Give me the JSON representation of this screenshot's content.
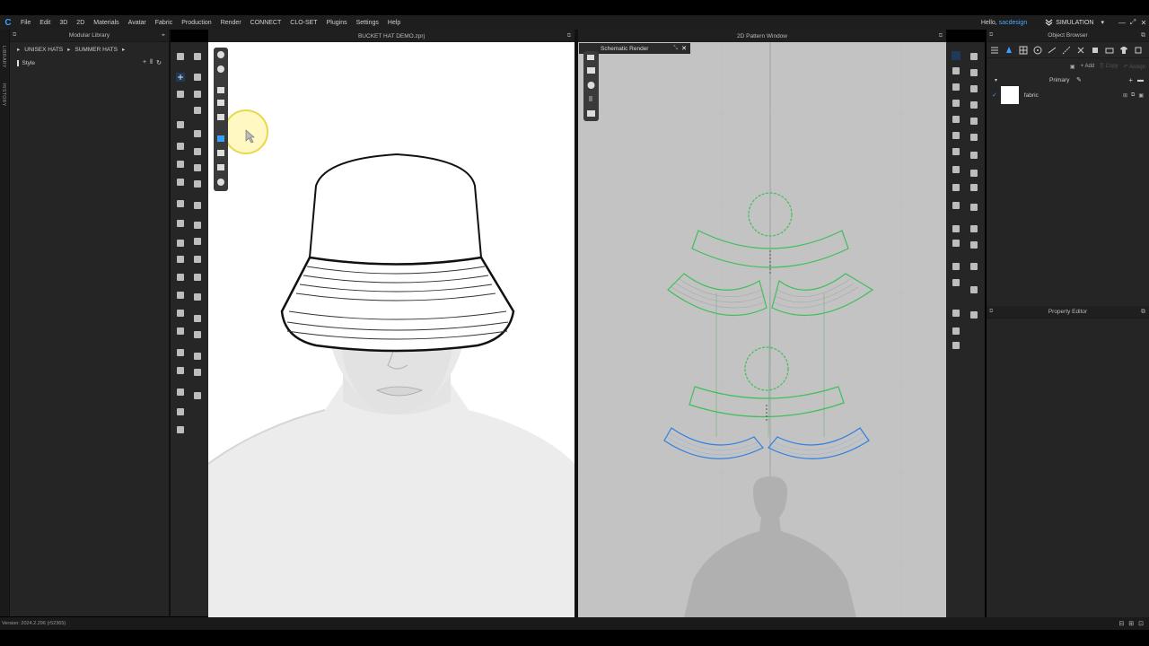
{
  "menu": {
    "items": [
      "File",
      "Edit",
      "3D",
      "2D",
      "Materials",
      "Avatar",
      "Fabric",
      "Production",
      "Render",
      "CONNECT",
      "CLO-SET",
      "Plugins",
      "Settings",
      "Help"
    ],
    "logo": "C"
  },
  "user": {
    "greeting": "Hello,",
    "name": "sacdesign"
  },
  "mode": {
    "label": "SIMULATION"
  },
  "side_tabs": [
    "LIBRARY",
    "HISTORY"
  ],
  "library": {
    "title": "Modular Library",
    "crumbs": [
      "UNISEX HATS",
      "SUMMER HATS"
    ],
    "style_label": "Style"
  },
  "viewport3d": {
    "title": "BUCKET HAT DEMO.zprj"
  },
  "viewport2d": {
    "title": "2D Pattern Window",
    "tab": "Schematic Render"
  },
  "object_browser": {
    "title": "Object Browser",
    "add_label": "Add",
    "copy_label": "Copy",
    "assign_label": "Assign",
    "group": "Primary",
    "fabric": "fabric"
  },
  "property_editor": {
    "title": "Property Editor"
  },
  "status": {
    "version": "Version: 2024.2.296 (r52365)"
  },
  "colors": {
    "accent": "#3aa0ff",
    "pattern_green": "#3fbf5a",
    "pattern_blue": "#2f7fe0"
  },
  "icons": [
    "search-icon",
    "close-icon",
    "minimize-icon",
    "maximize-icon",
    "chevron-down-icon",
    "plus-icon",
    "refresh-icon",
    "pin-icon",
    "pencil-icon",
    "folder-icon",
    "check-icon",
    "cursor-icon"
  ]
}
